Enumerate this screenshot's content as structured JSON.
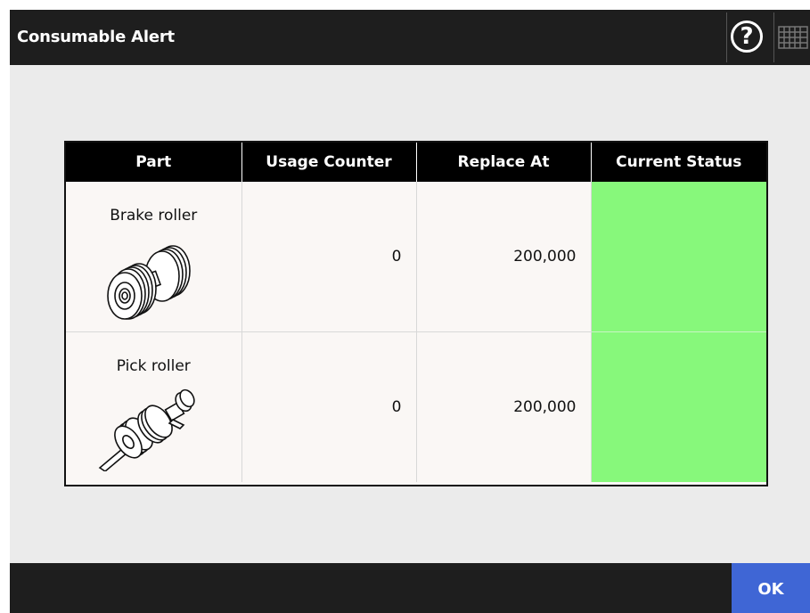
{
  "header": {
    "title": "Consumable Alert",
    "help_label": "?",
    "help_icon": "help-icon",
    "keyboard_icon": "keyboard-icon"
  },
  "table": {
    "columns": [
      "Part",
      "Usage Counter",
      "Replace At",
      "Current Status"
    ],
    "rows": [
      {
        "part": "Brake roller",
        "part_icon": "brake-roller-icon",
        "usage_counter": "0",
        "replace_at": "200,000",
        "status_color": "#87f87b"
      },
      {
        "part": "Pick roller",
        "part_icon": "pick-roller-icon",
        "usage_counter": "0",
        "replace_at": "200,000",
        "status_color": "#87f87b"
      }
    ]
  },
  "footer": {
    "ok_label": "OK"
  },
  "colors": {
    "titlebar": "#1e1e1e",
    "background": "#ebebeb",
    "ok_button": "#3f66d5",
    "status_ok": "#87f87b"
  }
}
